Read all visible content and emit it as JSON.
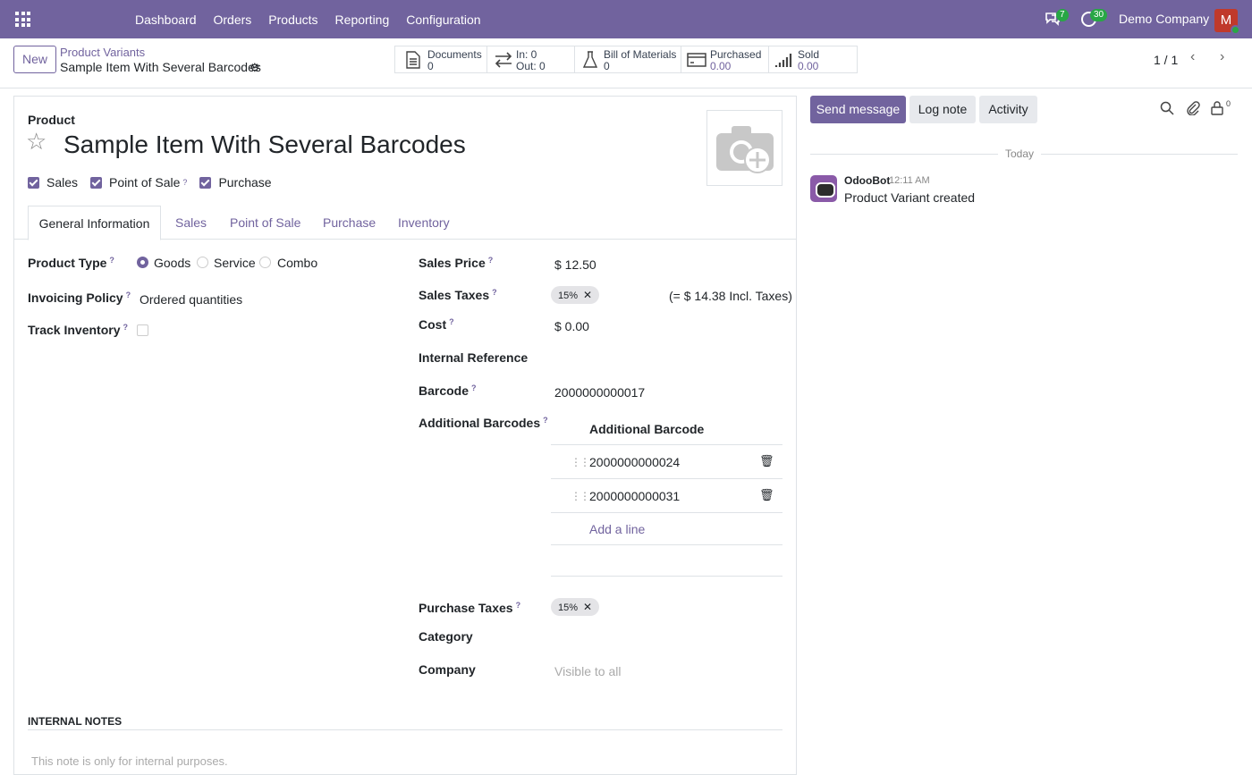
{
  "menu": [
    "Dashboard",
    "Orders",
    "Products",
    "Reporting",
    "Configuration"
  ],
  "system": {
    "chat_count": "7",
    "activity_count": "30",
    "company": "Demo Company",
    "avatar_letter": "M"
  },
  "controlpanel": {
    "new_label": "New",
    "breadcrumb_parent": "Product Variants",
    "breadcrumb_current": "Sample Item With Several Barcodes",
    "pager": "1 / 1",
    "stats": [
      {
        "icon": "document-icon",
        "l1": "Documents",
        "l2": "0"
      },
      {
        "icon": "transfer-icon",
        "l1": "In: 0",
        "l2": "Out: 0"
      },
      {
        "icon": "flask-icon",
        "l1": "Bill of Materials",
        "l2": "0"
      },
      {
        "icon": "credit-card-icon",
        "l1": "Purchased",
        "l2": "0.00"
      },
      {
        "icon": "signal-icon",
        "l1": "Sold",
        "l2": "0.00"
      }
    ]
  },
  "form": {
    "product_label": "Product",
    "name": "Sample Item With Several Barcodes",
    "checks": [
      "Sales",
      "Point of Sale",
      "Purchase"
    ],
    "tabs": [
      "General Information",
      "Sales",
      "Point of Sale",
      "Purchase",
      "Inventory"
    ],
    "product_type_label": "Product Type",
    "product_type_options": [
      "Goods",
      "Service",
      "Combo"
    ],
    "invoicing_label": "Invoicing Policy",
    "invoicing_value": "Ordered quantities",
    "track_label": "Track Inventory",
    "sales_price_label": "Sales Price",
    "sales_price": "$ 12.50",
    "sales_taxes_label": "Sales Taxes",
    "sales_tax_tag": "15%",
    "incl_taxes": "(= $ 14.38 Incl. Taxes)",
    "cost_label": "Cost",
    "cost": "$ 0.00",
    "internal_ref_label": "Internal Reference",
    "barcode_label": "Barcode",
    "barcode": "2000000000017",
    "additional_barcodes_label": "Additional Barcodes",
    "additional_barcode_header": "Additional Barcode",
    "additional_barcodes": [
      "2000000000024",
      "2000000000031"
    ],
    "add_line": "Add a line",
    "purchase_taxes_label": "Purchase Taxes",
    "purchase_tax_tag": "15%",
    "category_label": "Category",
    "company_label": "Company",
    "company_placeholder": "Visible to all",
    "internal_notes": "INTERNAL NOTES",
    "notes_placeholder": "This note is only for internal purposes."
  },
  "chatter": {
    "send_message": "Send message",
    "log_note": "Log note",
    "activity": "Activity",
    "followers": "0",
    "today": "Today",
    "author": "OdooBot",
    "time": "12:11 AM",
    "message": "Product Variant created"
  }
}
